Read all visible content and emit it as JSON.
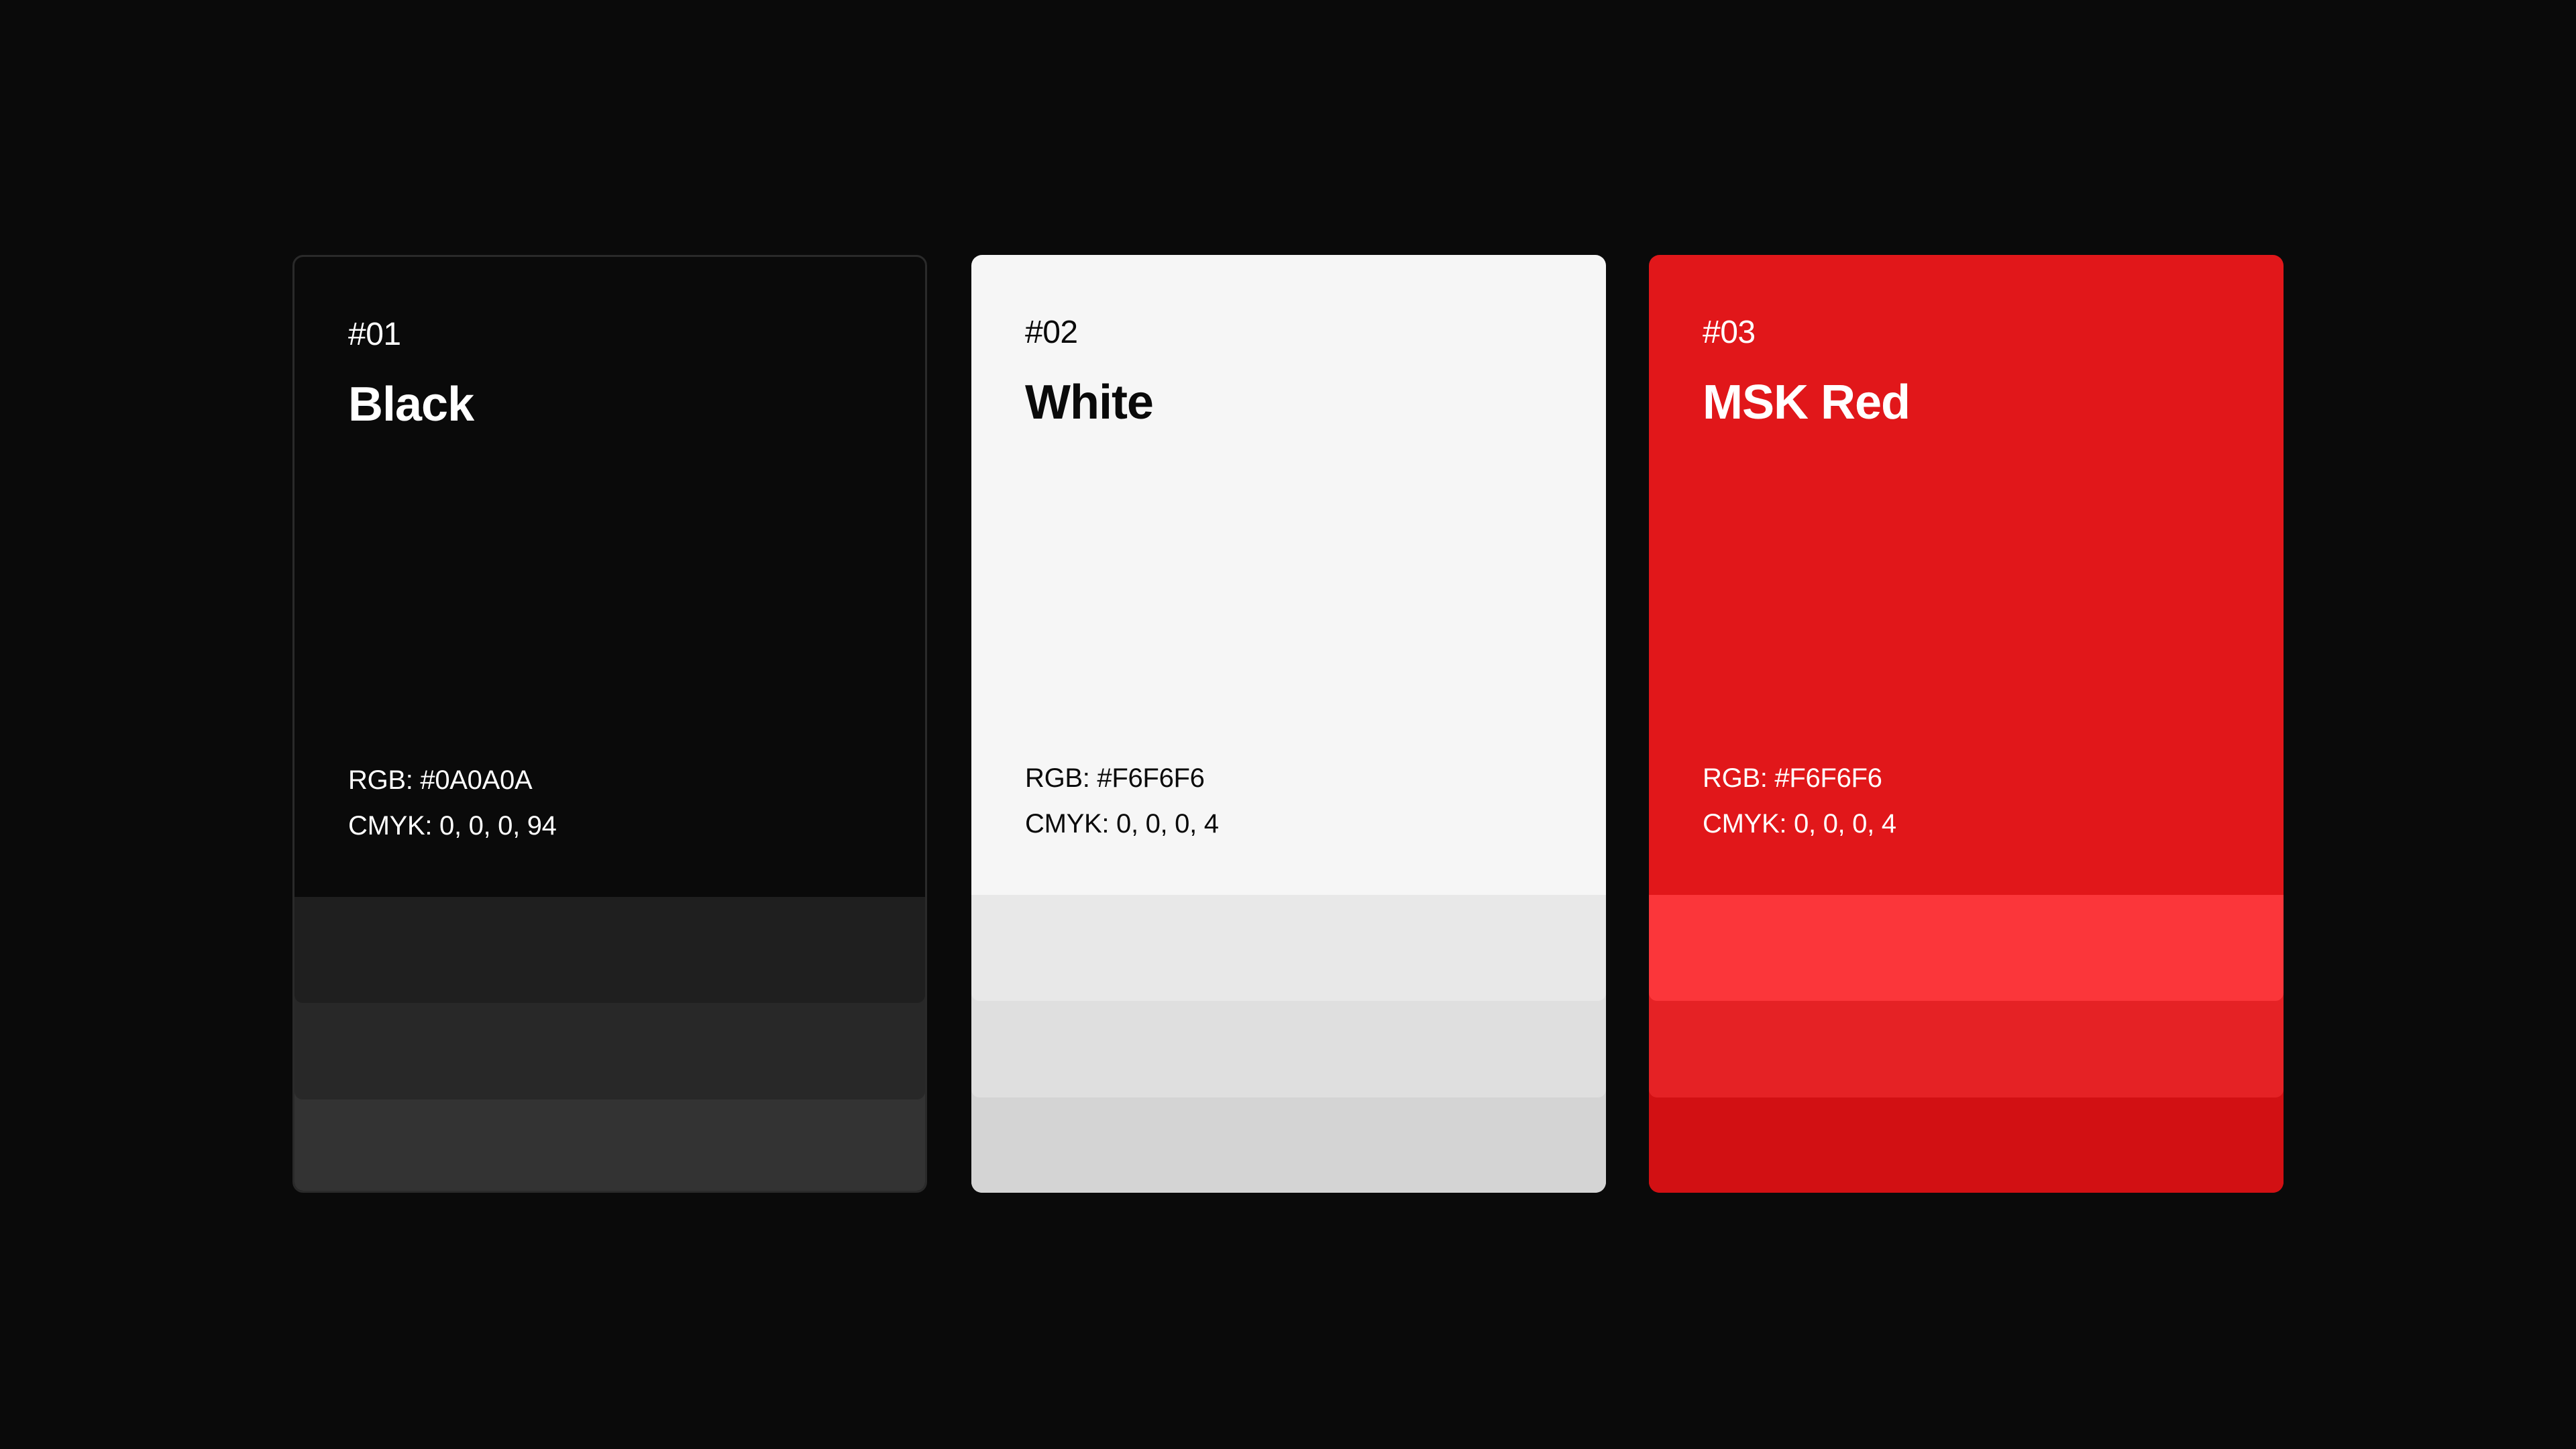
{
  "colors": {
    "page_background": "#0A0A0A"
  },
  "swatches": [
    {
      "number": "#01",
      "name": "Black",
      "rgb": "RGB: #0A0A0A",
      "cmyk": "CMYK: 0, 0, 0, 94",
      "base_color": "#0A0A0A",
      "text_color": "#FFFFFF",
      "shades": [
        "#1F1F1F",
        "#282828",
        "#333333"
      ]
    },
    {
      "number": "#02",
      "name": "White",
      "rgb": "RGB: #F6F6F6",
      "cmyk": "CMYK: 0, 0, 0, 4",
      "base_color": "#F6F6F6",
      "text_color": "#0A0A0A",
      "shades": [
        "#E8E8E8",
        "#DFDFDF",
        "#D4D4D4"
      ]
    },
    {
      "number": "#03",
      "name": "MSK Red",
      "rgb": "RGB: #F6F6F6",
      "cmyk": "CMYK: 0, 0, 0, 4",
      "base_color": "#E1171A",
      "text_color": "#FFFFFF",
      "shades": [
        "#FB363A",
        "#E52225",
        "#D21013"
      ]
    }
  ]
}
